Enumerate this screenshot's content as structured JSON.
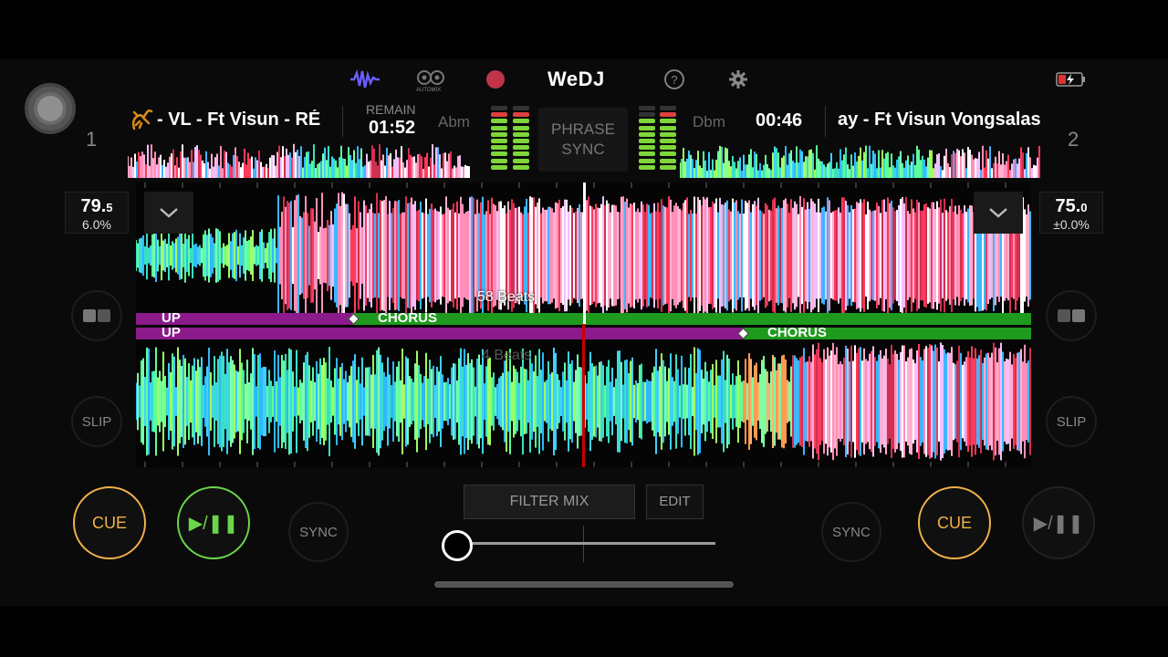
{
  "app": {
    "name": "WeDJ"
  },
  "toolbar": {
    "automix_label": "AUTOMIX"
  },
  "deck_left": {
    "number": "1",
    "title": "- VL - Ft Visun -  RÉ",
    "remain_label": "REMAIN",
    "remain_time": "01:52",
    "key": "Abm",
    "bpm_main": "79.",
    "bpm_decimal": "5",
    "pitch": "6.0%",
    "cue_label": "CUE",
    "play_label": "▶/❚❚",
    "sync_label": "SYNC",
    "slip_label": "SLIP",
    "phrase_up": "UP",
    "phrase_chorus": "CHORUS",
    "beats": "58 Beats"
  },
  "deck_right": {
    "number": "2",
    "title": "ay - Ft Visun Vongsalas",
    "time": "00:46",
    "key": "Dbm",
    "bpm_main": "75.",
    "bpm_decimal": "0",
    "pitch": "±0.0%",
    "cue_label": "CUE",
    "play_label": "▶/❚❚",
    "sync_label": "SYNC",
    "slip_label": "SLIP",
    "phrase_up": "UP",
    "phrase_chorus": "CHORUS",
    "beats": "4 Beats"
  },
  "center": {
    "phrase_sync_line1": "PHRASE",
    "phrase_sync_line2": "SYNC",
    "filter_mix_label": "FILTER MIX",
    "edit_label": "EDIT"
  },
  "crossfader": {
    "position": 0.0
  },
  "colors": {
    "accent_cue": "#f2b24a",
    "accent_play": "#6bd64b",
    "phrase_up": "#8b1a8b",
    "phrase_chorus": "#1e9a1e",
    "waveform_icon": "#6a5cff",
    "record": "#c0344a"
  },
  "icons": [
    "waveform-icon",
    "automix-icon",
    "record-icon",
    "help-icon",
    "gear-icon",
    "battery-charging-icon",
    "chevron-down-icon",
    "slip-mode-icon"
  ]
}
